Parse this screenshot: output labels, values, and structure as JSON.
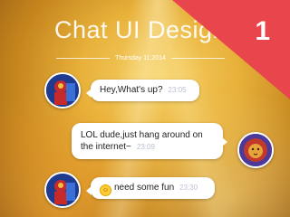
{
  "header": {
    "title": "Chat UI Design",
    "date": "Thursday 11,2014"
  },
  "ribbon": {
    "number": "1",
    "color": "#e8454c"
  },
  "messages": [
    {
      "sender": "left",
      "text": "Hey,What's up?",
      "time": "23:05"
    },
    {
      "sender": "right",
      "text": "LOL dude,just hang around on the internet~",
      "time": "23:09"
    },
    {
      "sender": "left",
      "text": "need some fun",
      "time": "23:30",
      "emoji": "smile-emoji"
    }
  ],
  "icons": {
    "avatar_left": "superhero-avatar",
    "avatar_right": "lion-avatar"
  }
}
